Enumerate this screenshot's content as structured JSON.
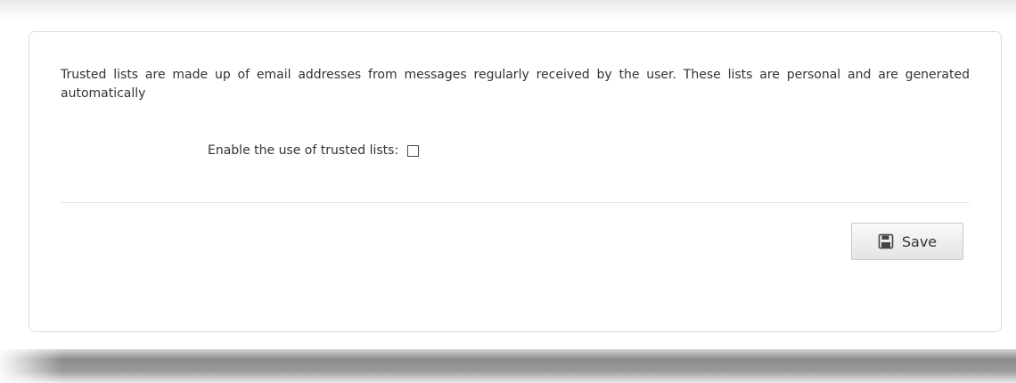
{
  "trusted_lists": {
    "description": "Trusted lists are made up of email addresses from messages regularly received by the user. These lists are personal and are generated automatically",
    "enable_label": "Enable the use of trusted lists:",
    "enable_checked": false,
    "save_label": "Save"
  },
  "icons": {
    "save": "floppy-disk-icon"
  },
  "colors": {
    "text": "#333333",
    "panel_border": "#dcdcdc",
    "button_border": "#c8c8c8"
  }
}
